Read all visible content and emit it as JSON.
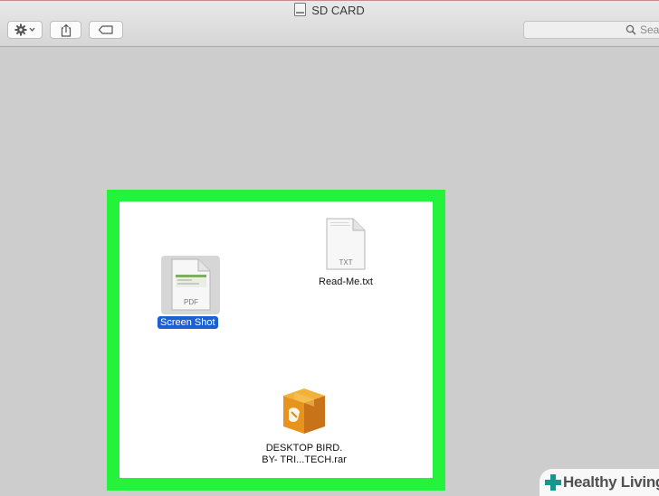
{
  "window": {
    "title": "SD CARD"
  },
  "toolbar": {
    "action_icon": "gear-icon",
    "share_icon": "share-icon",
    "tag_icon": "tag-icon",
    "search_placeholder": "Sea"
  },
  "files": [
    {
      "name": "Screen Shot",
      "type": "PDF",
      "selected": true
    },
    {
      "name": "Read-Me.txt",
      "type": "TXT",
      "selected": false
    },
    {
      "name_line1": "DESKTOP BIRD.",
      "name_line2": "BY- TRI...TECH.rar",
      "type": "archive",
      "selected": false
    }
  ],
  "highlight": {
    "color": "#24f23b"
  },
  "watermark": {
    "text": "Healthy Living",
    "mark_color": "#0f9a8c"
  },
  "colors": {
    "selection": "#1c5fd3",
    "toolbar_bg": "#e0e0e0",
    "window_bg": "#cdcdcd"
  }
}
